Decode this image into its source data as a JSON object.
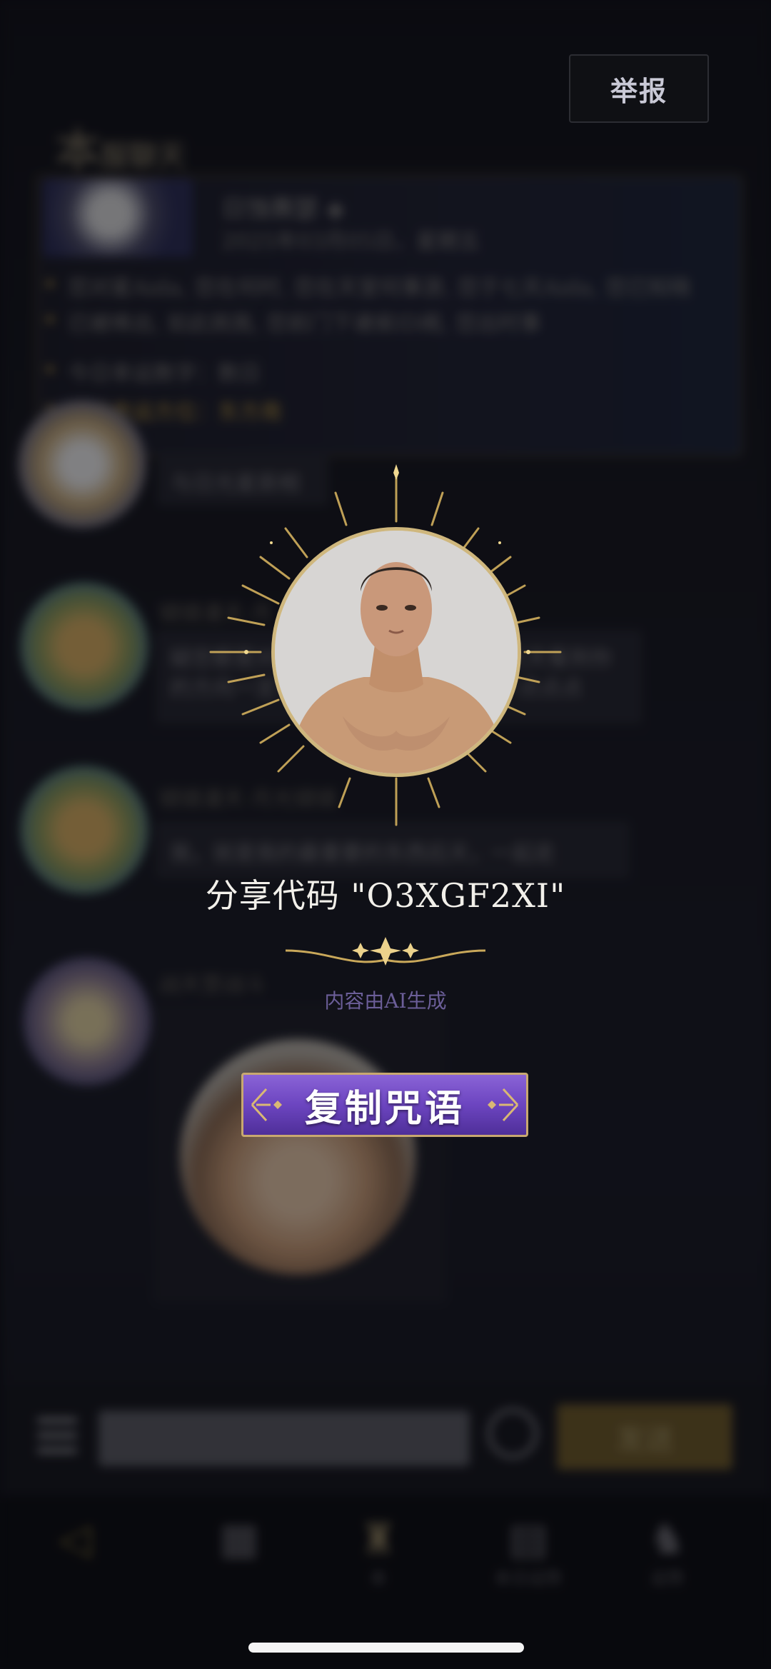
{
  "header": {
    "report_label": "举报",
    "chat_title": "本",
    "chat_title_small": "服聊天"
  },
  "info_card": {
    "name": "日蚀赛瑟 ◈",
    "date": "2025年03月05日，星期五",
    "lines": [
      "您对星Aida, 您在何时, 您在天堂何事游, 您于七天Aida, 您已知晓",
      "已被唤出, 如此挑我, 您前门下诸侯ID阁, 您出时事",
      "今日幸运数字：数日",
      "今日幸运方位：",
      "东方南"
    ]
  },
  "messages": [
    {
      "name": "",
      "text": "与日光星辰相"
    },
    {
      "name": "镜镜漫天·月",
      "text": "疑您都是对你的想法, 我现在在前方天天看到你的方向一定一起, 现在的你, 就会有一点点点"
    },
    {
      "name": "镜镜漫天·月光镜镜",
      "text": "我，就是我的最重要的东西后天，一起走"
    },
    {
      "name": "战天罡战斗",
      "text": ""
    }
  ],
  "input": {
    "send_label": "发送"
  },
  "nav": {
    "items": [
      "",
      "本",
      "",
      "本日运势",
      "运势"
    ]
  },
  "modal": {
    "share_code": "分享代码 \"O3XGF2XI\"",
    "ai_note": "内容由AI生成",
    "copy_label": "复制咒语"
  },
  "colors": {
    "gold": "#cfb77d",
    "purple": "#6c45c0",
    "bg": "#0c0d12"
  }
}
